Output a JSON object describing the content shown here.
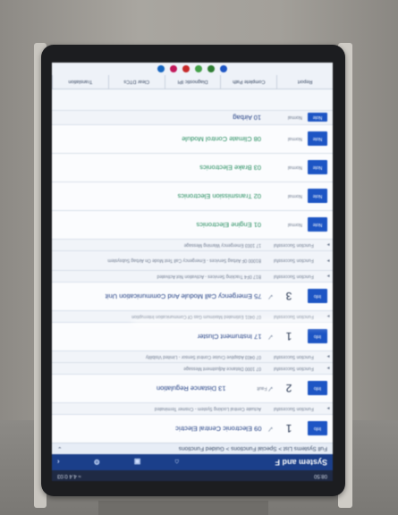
{
  "scene": {
    "colors": {
      "title_bar": "#1b3f8a",
      "info_button": "#1d55c4",
      "green_text": "#1f8a5a"
    }
  },
  "status_bar": {
    "time": "08:50",
    "right": "≈ 4.4 0:03"
  },
  "app": {
    "title": "System and F"
  },
  "breadcrumb": {
    "text": "Full Systems List > Special Functions > Guided Functions"
  },
  "systems": [
    {
      "name": "09 Electronic Central Electric",
      "level": "1",
      "status": "",
      "button": "Info",
      "style": "blue"
    },
    {
      "name": "Actuate Central Locking System - Cnsmer Terminated",
      "status": "Function Successful",
      "kind": "small"
    },
    {
      "name": "13 Distance Regulation",
      "level": "2",
      "extra": "Fault",
      "button": "Info",
      "style": "blue"
    },
    {
      "name": "07 1000 Distance Adjustment Message",
      "status": "Function Successful",
      "kind": "small"
    },
    {
      "name": "07 0403 Adaptive Cruise Control Sensor - Limited Visibility",
      "status": "Function Successful",
      "kind": "small"
    },
    {
      "name": "17 Instrument Cluster",
      "level": "1",
      "button": "Info",
      "style": "blue"
    },
    {
      "name": "07 0401 Estimated Maximum Gas Of Communication Interruption",
      "status": "Function Successful",
      "kind": "small"
    },
    {
      "name": "75 Emergency Call Module And Communication Unit",
      "level": "3",
      "button": "Info",
      "style": "blue"
    },
    {
      "name": "B17 0F4 Tracking Services - Activation Not Activated",
      "status": "Function Successful",
      "kind": "small"
    },
    {
      "name": "B1000 0F Airbag Services - Emergency Call Test Mode On Airbag Subsystem",
      "status": "Function Successful",
      "kind": "medium"
    },
    {
      "name": "17 1003 Emergency Warning Message",
      "status": "Function Successful",
      "kind": "small"
    },
    {
      "name": "01 Engine Electronics",
      "status": "Normal",
      "button": "Note",
      "style": "green"
    },
    {
      "name": "02 Transmission Electronics",
      "status": "Normal",
      "button": "Note",
      "style": "green"
    },
    {
      "name": "03 Brake Electronics",
      "status": "Normal",
      "button": "Note",
      "style": "green"
    },
    {
      "name": "08 Climate Control Module",
      "status": "Normal",
      "button": "Note",
      "style": "green"
    },
    {
      "name": "10 Airbag",
      "status": "Normal",
      "button": "Note",
      "style": "blue"
    }
  ],
  "tabs": [
    "Report",
    "Complete Path",
    "Diagnostic IPI",
    "Clear DTCs",
    "Translation"
  ]
}
